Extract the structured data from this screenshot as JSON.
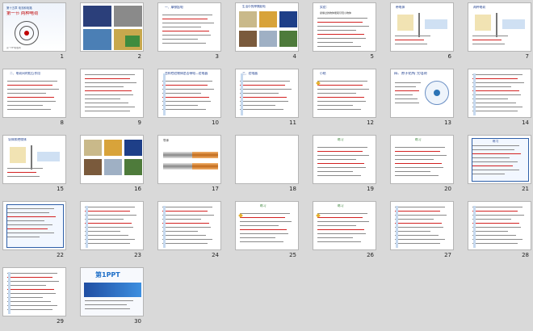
{
  "slides": [
    {
      "n": "1",
      "kind": "title",
      "lines": [
        "第十五章 电流和电路",
        "第一节 两种电荷"
      ],
      "footer": "第一PPT模板网"
    },
    {
      "n": "2",
      "kind": "photos"
    },
    {
      "n": "3",
      "kind": "text",
      "head": "一、摩擦起电"
    },
    {
      "n": "4",
      "kind": "photogrid",
      "head": "生活中的摩擦起电"
    },
    {
      "n": "5",
      "kind": "text",
      "head": "实验：",
      "head2": "摩擦过的物体能吸引轻小物体"
    },
    {
      "n": "6",
      "kind": "diagram",
      "head": "带电体"
    },
    {
      "n": "7",
      "kind": "diagram",
      "head": "两种电荷"
    },
    {
      "n": "8",
      "kind": "text",
      "head": "二、电荷间的相互作用"
    },
    {
      "n": "9",
      "kind": "text"
    },
    {
      "n": "10",
      "kind": "text",
      "head": "怎样检验物体是否带电—验电器"
    },
    {
      "n": "11",
      "kind": "text",
      "head": "三、验电器"
    },
    {
      "n": "12",
      "kind": "text",
      "head": "小结"
    },
    {
      "n": "13",
      "kind": "atom",
      "head": "四、原子结构 元电荷"
    },
    {
      "n": "14",
      "kind": "text"
    },
    {
      "n": "15",
      "kind": "diagram",
      "head": "导体和绝缘体"
    },
    {
      "n": "16",
      "kind": "photogrid"
    },
    {
      "n": "17",
      "kind": "wires",
      "head": "导体"
    },
    {
      "n": "18",
      "kind": "blank"
    },
    {
      "n": "19",
      "kind": "text",
      "head": "练习"
    },
    {
      "n": "20",
      "kind": "text",
      "head": "练习"
    },
    {
      "n": "21",
      "kind": "boxed",
      "head": "练习"
    },
    {
      "n": "22",
      "kind": "boxed"
    },
    {
      "n": "23",
      "kind": "text"
    },
    {
      "n": "24",
      "kind": "text"
    },
    {
      "n": "25",
      "kind": "text",
      "head": "练习"
    },
    {
      "n": "26",
      "kind": "text",
      "head": "练习"
    },
    {
      "n": "27",
      "kind": "text"
    },
    {
      "n": "28",
      "kind": "text"
    },
    {
      "n": "29",
      "kind": "text"
    },
    {
      "n": "30",
      "kind": "ad",
      "brand": "第1PPT"
    }
  ]
}
